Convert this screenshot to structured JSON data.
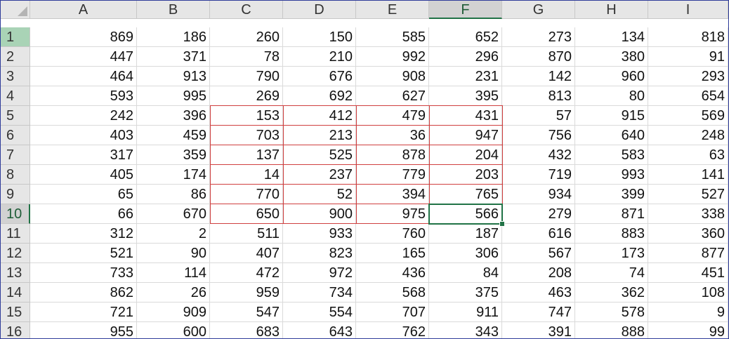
{
  "columns": [
    "A",
    "B",
    "C",
    "D",
    "E",
    "F",
    "G",
    "H",
    "I"
  ],
  "selected_column": "F",
  "selected_row": 10,
  "rows": [
    {
      "n": "1",
      "v": [
        "869",
        "186",
        "260",
        "150",
        "585",
        "652",
        "273",
        "134",
        "818"
      ]
    },
    {
      "n": "2",
      "v": [
        "447",
        "371",
        "78",
        "210",
        "992",
        "296",
        "870",
        "380",
        "91"
      ]
    },
    {
      "n": "3",
      "v": [
        "464",
        "913",
        "790",
        "676",
        "908",
        "231",
        "142",
        "960",
        "293"
      ]
    },
    {
      "n": "4",
      "v": [
        "593",
        "995",
        "269",
        "692",
        "627",
        "395",
        "813",
        "80",
        "654"
      ]
    },
    {
      "n": "5",
      "v": [
        "242",
        "396",
        "153",
        "412",
        "479",
        "431",
        "57",
        "915",
        "569"
      ]
    },
    {
      "n": "6",
      "v": [
        "403",
        "459",
        "703",
        "213",
        "36",
        "947",
        "756",
        "640",
        "248"
      ]
    },
    {
      "n": "7",
      "v": [
        "317",
        "359",
        "137",
        "525",
        "878",
        "204",
        "432",
        "583",
        "63"
      ]
    },
    {
      "n": "8",
      "v": [
        "405",
        "174",
        "14",
        "237",
        "779",
        "203",
        "719",
        "993",
        "141"
      ]
    },
    {
      "n": "9",
      "v": [
        "65",
        "86",
        "770",
        "52",
        "394",
        "765",
        "934",
        "399",
        "527"
      ]
    },
    {
      "n": "10",
      "v": [
        "66",
        "670",
        "650",
        "900",
        "975",
        "566",
        "279",
        "871",
        "338"
      ]
    },
    {
      "n": "11",
      "v": [
        "312",
        "2",
        "511",
        "933",
        "760",
        "187",
        "616",
        "883",
        "360"
      ]
    },
    {
      "n": "12",
      "v": [
        "521",
        "90",
        "407",
        "823",
        "165",
        "306",
        "567",
        "173",
        "877"
      ]
    },
    {
      "n": "13",
      "v": [
        "733",
        "114",
        "472",
        "972",
        "436",
        "84",
        "208",
        "74",
        "451"
      ]
    },
    {
      "n": "14",
      "v": [
        "862",
        "26",
        "959",
        "734",
        "568",
        "375",
        "463",
        "362",
        "108"
      ]
    },
    {
      "n": "15",
      "v": [
        "721",
        "909",
        "547",
        "554",
        "707",
        "911",
        "747",
        "578",
        "9"
      ]
    },
    {
      "n": "16",
      "v": [
        "955",
        "600",
        "683",
        "643",
        "762",
        "343",
        "391",
        "888",
        "99"
      ]
    }
  ],
  "highlight_color": "#d04040",
  "accent_color": "#217346"
}
